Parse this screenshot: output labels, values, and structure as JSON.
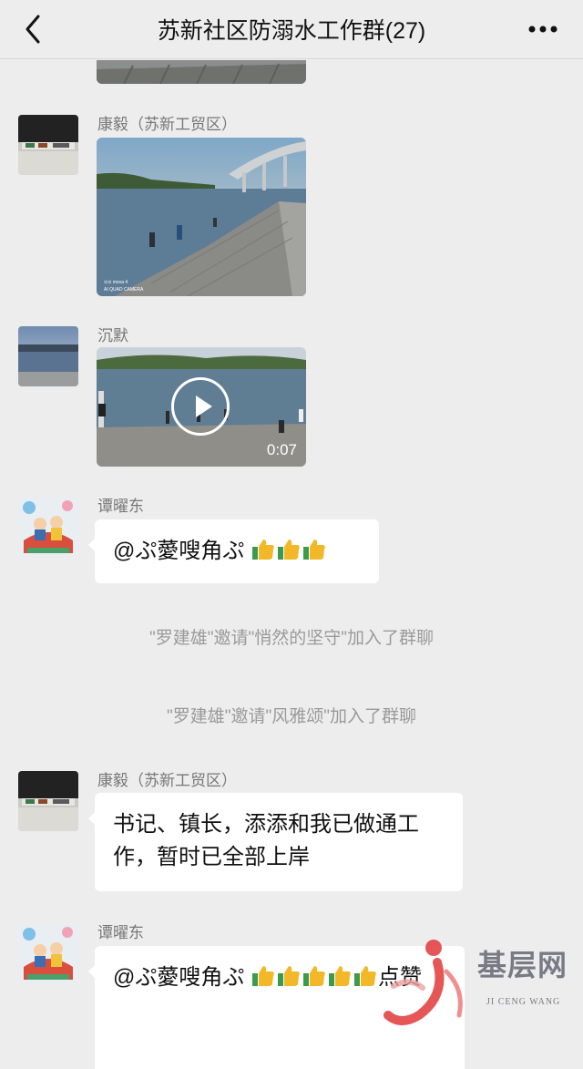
{
  "header": {
    "title": "苏新社区防溺水工作群(27)",
    "back_icon": "chevron-left-icon",
    "more_icon": "more-dots-icon"
  },
  "messages": [
    {
      "type": "image-partial",
      "sender": "",
      "watermark": "⊙⊙ mova 4\nAI QUAD CAMERA"
    },
    {
      "type": "image",
      "sender": "康毅（苏新工贸区）",
      "watermark": "⊙⊙ mova 4\nAI QUAD CAMERA"
    },
    {
      "type": "video",
      "sender": "沉默",
      "duration": "0:07"
    },
    {
      "type": "text",
      "sender": "谭曜东",
      "text": "@ぷ薆嗖角ぷ"
    },
    {
      "type": "system",
      "text": "\"罗建雄\"邀请\"悄然的坚守\"加入了群聊"
    },
    {
      "type": "system",
      "text": "\"罗建雄\"邀请\"风雅颂\"加入了群聊"
    },
    {
      "type": "text",
      "sender": "康毅（苏新工贸区）",
      "text": "书记、镇长，添添和我已做通工作，暂时已全部上岸"
    },
    {
      "type": "text",
      "sender": "谭曜东",
      "text": "@ぷ薆嗖角ぷ",
      "text_tail": "点赞"
    }
  ],
  "watermark_logo": {
    "name": "基层网",
    "sub": "JI CENG WANG"
  },
  "colors": {
    "background": "#ededed",
    "bubble": "#ffffff",
    "system_text": "#9a9a9a"
  }
}
